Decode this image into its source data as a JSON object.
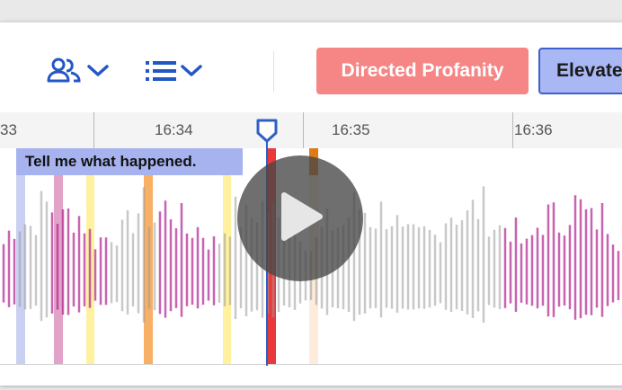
{
  "toolbar": {
    "speaker_icon": "speakers-icon",
    "list_icon": "list-icon",
    "tags": [
      {
        "label": "Directed Profanity",
        "color": "#f68585"
      },
      {
        "label": "Elevate",
        "color": "#a9b8f5"
      }
    ]
  },
  "timeline": {
    "ticks": [
      "33",
      "16:34",
      "16:35",
      "16:36"
    ]
  },
  "caption": {
    "text": "Tell me what happened."
  },
  "colors": {
    "accent_blue": "#2f5fc4",
    "speaker_a": "#b2228f",
    "speaker_b": "#9c9c9c",
    "highlight_yellow": "#fff1a0",
    "highlight_orange": "#f6a24a",
    "highlight_red": "#e83a3a",
    "highlight_pink": "#e2a3c8",
    "highlight_lavender": "#c9d0f1"
  },
  "player": {
    "play_icon": "play-icon"
  }
}
